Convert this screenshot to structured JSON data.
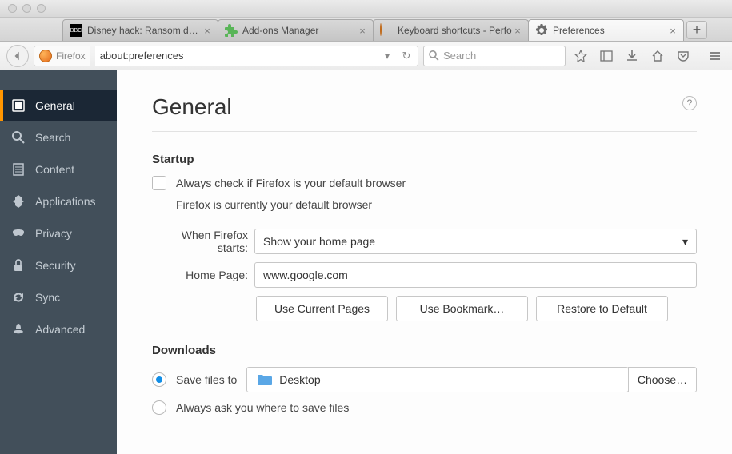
{
  "tabs": [
    {
      "label": "Disney hack: Ransom dem"
    },
    {
      "label": "Add-ons Manager"
    },
    {
      "label": "Keyboard shortcuts - Perfo"
    },
    {
      "label": "Preferences"
    }
  ],
  "nav": {
    "identity": "Firefox",
    "url": "about:preferences",
    "search_placeholder": "Search"
  },
  "sidebar": {
    "items": [
      {
        "label": "General"
      },
      {
        "label": "Search"
      },
      {
        "label": "Content"
      },
      {
        "label": "Applications"
      },
      {
        "label": "Privacy"
      },
      {
        "label": "Security"
      },
      {
        "label": "Sync"
      },
      {
        "label": "Advanced"
      }
    ]
  },
  "page": {
    "title": "General",
    "startup": {
      "title": "Startup",
      "default_check": "Always check if Firefox is your default browser",
      "status": "Firefox is currently your default browser",
      "when_starts_label": "When Firefox starts:",
      "when_starts_value": "Show your home page",
      "home_page_label": "Home Page:",
      "home_page_value": "www.google.com",
      "use_current": "Use Current Pages",
      "use_bookmark": "Use Bookmark…",
      "restore": "Restore to Default"
    },
    "downloads": {
      "title": "Downloads",
      "save_to_label": "Save files to",
      "save_to_value": "Desktop",
      "choose": "Choose…",
      "always_ask": "Always ask you where to save files"
    }
  }
}
